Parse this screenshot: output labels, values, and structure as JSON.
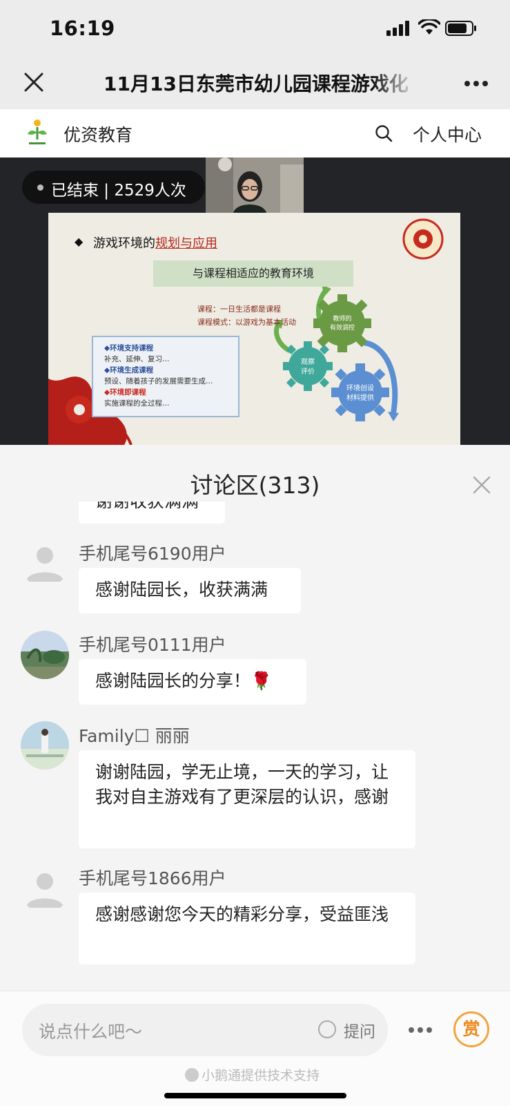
{
  "status_bar": {
    "time": "16:19"
  },
  "title_bar": {
    "title": "11月13日东莞市幼儿园课程游戏化"
  },
  "site_header": {
    "site_name": "优资教育",
    "user_center": "个人中心"
  },
  "video": {
    "live_status": "已结束 | 2529人次",
    "slide": {
      "heading_prefix": "游戏环境的",
      "heading_highlight": "规划与应用",
      "banner": "与课程相适应的教育环境",
      "course_line1": "课程：一日生活都是课程",
      "course_line2": "课程模式：以游戏为基本活动",
      "box_items": [
        {
          "title": "◆环境支持课程",
          "desc": "补充、延伸、复习…",
          "color": "blue"
        },
        {
          "title": "◆环境生成课程",
          "desc": "预设、随着孩子的发展需要生成…",
          "color": "blue"
        },
        {
          "title": "◆环境即课程",
          "desc": "实施课程的全过程…",
          "color": "red"
        }
      ],
      "gear_top": [
        "教师的",
        "有效调控"
      ],
      "gear_left": [
        "观察",
        "评价"
      ],
      "gear_right": [
        "环境创设",
        "材料提供"
      ]
    }
  },
  "discussion": {
    "title": "讨论区(313)",
    "partial_message": "谢谢收获满满",
    "messages": [
      {
        "user": "手机尾号6190用户",
        "text": "感谢陆园长，收获满满"
      },
      {
        "user": "手机尾号0111用户",
        "text": "感谢陆园长的分享！🌹"
      },
      {
        "user": "Family☐ 丽丽",
        "text": "谢谢陆园，学无止境，一天的学习，让我对自主游戏有了更深层的认识，感谢"
      },
      {
        "user": "手机尾号1866用户",
        "text": "感谢感谢您今天的精彩分享，受益匪浅"
      }
    ]
  },
  "bottom_bar": {
    "input_placeholder": "说点什么吧～",
    "ask_label": "提问",
    "reward_label": "赏",
    "powered_by": "小鹅通提供技术支持"
  },
  "colors": {
    "accent_orange": "#ee8a1a",
    "slide_red": "#b5281c",
    "slide_blue": "#2c4e9a"
  }
}
